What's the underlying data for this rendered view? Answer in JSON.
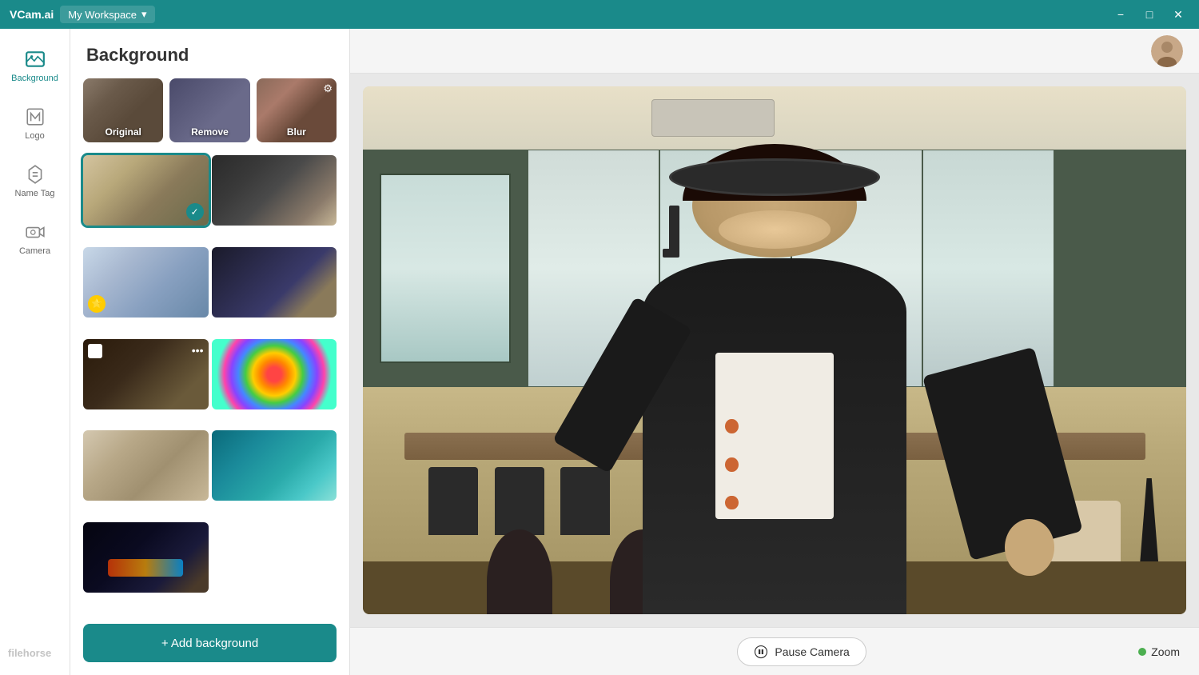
{
  "titleBar": {
    "brand": "VCam.ai",
    "workspace": "My Workspace",
    "chevronDown": "▾",
    "minimizeLabel": "−",
    "maximizeLabel": "□",
    "closeLabel": "✕"
  },
  "sidebar": {
    "items": [
      {
        "id": "background",
        "label": "Background",
        "icon": "🖼",
        "active": true
      },
      {
        "id": "logo",
        "label": "Logo",
        "icon": "◈",
        "active": false
      },
      {
        "id": "nametag",
        "label": "Name Tag",
        "icon": "🏷",
        "active": false
      },
      {
        "id": "camera",
        "label": "Camera",
        "icon": "📷",
        "active": false
      }
    ]
  },
  "panel": {
    "title": "Background",
    "filters": [
      {
        "id": "original",
        "label": "Original",
        "hasGear": false
      },
      {
        "id": "remove",
        "label": "Remove",
        "hasGear": false
      },
      {
        "id": "blur",
        "label": "Blur",
        "hasGear": true
      }
    ],
    "backgrounds": [
      {
        "id": "bg1",
        "selected": true,
        "hasPremium": false,
        "colorClass": "bg-office1"
      },
      {
        "id": "bg2",
        "selected": false,
        "hasPremium": false,
        "colorClass": "bg-office2"
      },
      {
        "id": "bg3",
        "selected": false,
        "hasPremium": true,
        "colorClass": "bg-modern1"
      },
      {
        "id": "bg4",
        "selected": false,
        "hasPremium": false,
        "colorClass": "bg-dark1"
      },
      {
        "id": "bg5",
        "selected": false,
        "hasPremium": false,
        "hasMore": true,
        "hasWhiteBox": true,
        "colorClass": "bg-dark1"
      },
      {
        "id": "bg6",
        "selected": false,
        "hasPremium": false,
        "colorClass": "bg-colorful"
      },
      {
        "id": "bg7",
        "selected": false,
        "hasPremium": false,
        "colorClass": "bg-living"
      },
      {
        "id": "bg8",
        "selected": false,
        "hasPremium": false,
        "colorClass": "bg-teal"
      },
      {
        "id": "bg9",
        "selected": false,
        "hasPremium": false,
        "colorClass": "bg-laptop"
      }
    ],
    "addButton": "+ Add background"
  },
  "preview": {
    "pauseButton": "Pause Camera",
    "zoomLabel": "Zoom"
  },
  "filehorse": "filehorse"
}
